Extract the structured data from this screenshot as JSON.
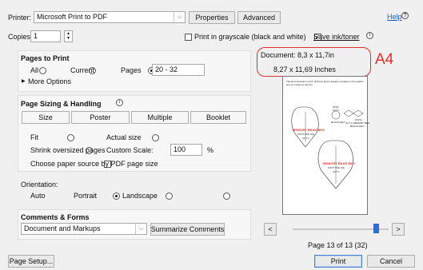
{
  "printer": {
    "label": "Printer:",
    "value": "Microsoft Print to PDF",
    "properties": "Properties",
    "advanced": "Advanced"
  },
  "help": {
    "label": "Help"
  },
  "copies": {
    "label": "Copies:",
    "value": "1"
  },
  "options": {
    "grayscale": "Print in grayscale (black and white)",
    "save_ink": "Save ink/toner"
  },
  "document": {
    "line1": "Document: 8,3 x 11,7in",
    "line2": "8,27 x 11,69 Inches",
    "annotation": "A4"
  },
  "pages_to_print": {
    "title": "Pages to Print",
    "all": "All",
    "current": "Current",
    "pages": "Pages",
    "range": "20 - 32",
    "more": "More Options"
  },
  "sizing": {
    "title": "Page Sizing & Handling",
    "buttons": [
      "Size",
      "Poster",
      "Multiple",
      "Booklet"
    ],
    "fit": "Fit",
    "actual": "Actual size",
    "shrink": "Shrink oversized pages",
    "custom": "Custom Scale:",
    "scale": "100",
    "percent": "%",
    "choose_source": "Choose paper source by PDF page size"
  },
  "orientation": {
    "title": "Orientation:",
    "auto": "Auto",
    "portrait": "Portrait",
    "landscape": "Landscape"
  },
  "comments": {
    "title": "Comments & Forms",
    "value": "Document and Markups",
    "summarize": "Summarize Comments"
  },
  "preview": {
    "page_info": "Page 13 of 13 (32)",
    "prev": "<",
    "next": ">",
    "tag_line": "The short direction is 1/4\" (6.5mm) and is already included on the pattern as it is mostly on the line.",
    "label_top": "MEMORY BEAR BEN",
    "foot": "FOOT PAD (01)",
    "cut": "CUT 1",
    "note1": "NOW",
    "note2": "CUT 1",
    "note3": "BLACK FELT",
    "note4": "COOL",
    "note5": "CUT 1 MEMORY BEN",
    "note6": "BLACK FELT"
  },
  "footer": {
    "setup": "Page Setup...",
    "print": "Print",
    "cancel": "Cancel"
  }
}
